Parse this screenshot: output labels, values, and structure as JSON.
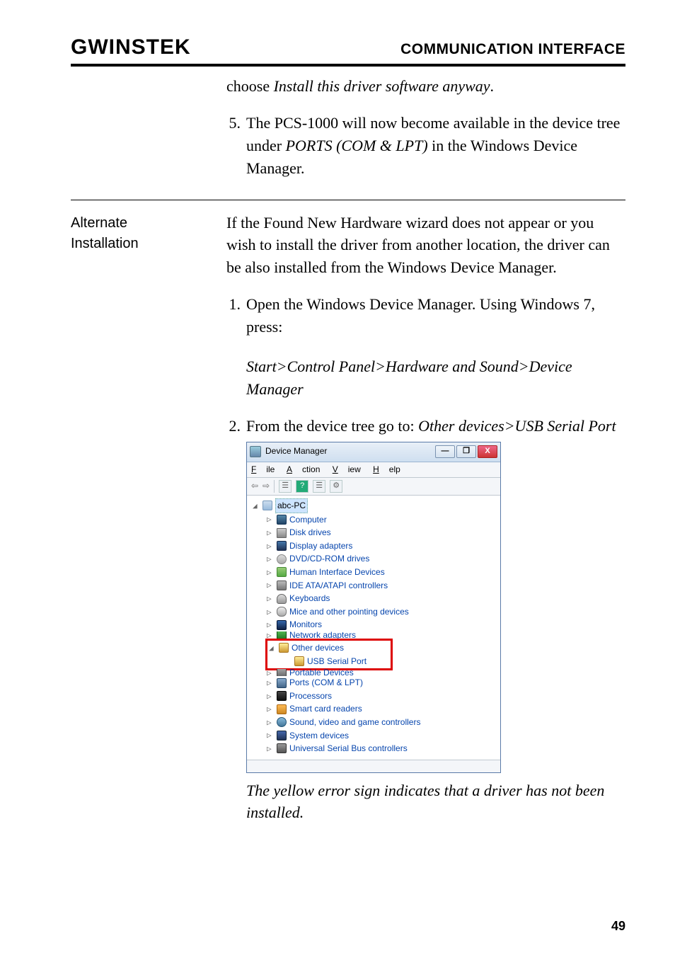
{
  "header": {
    "logo": "GWINSTEK",
    "section": "COMMUNICATION INTERFACE"
  },
  "top_block": {
    "choose_line_prefix": "choose ",
    "choose_line_italic": "Install this driver software anyway",
    "choose_line_suffix": ".",
    "step5_num": "5.",
    "step5_a": "The PCS-1000 will now become available in the device tree under ",
    "step5_i": "PORTS (COM & LPT)",
    "step5_b": " in the Windows Device Manager."
  },
  "alt": {
    "label_a": "Alternate",
    "label_b": "Installation",
    "intro": "If the Found New Hardware wizard does not appear or you wish to install the driver from another location, the driver can be also installed from the Windows Device Manager.",
    "step1_num": "1.",
    "step1_a": "Open the Windows Device Manager. Using Windows 7, press:",
    "step1_path": "Start>Control Panel>Hardware and Sound>Device Manager",
    "step2_num": "2.",
    "step2_a": "From the device tree go to: ",
    "step2_i": "Other devices>USB Serial Port"
  },
  "dm": {
    "title": "Device Manager",
    "min": "—",
    "restore": "❐",
    "close": "X",
    "menu": {
      "file": "File",
      "action": "Action",
      "view": "View",
      "help": "Help"
    },
    "tb_back": "⇦",
    "tb_fwd": "⇨",
    "tb_prop": "☰",
    "tb_help": "?",
    "tb_scan": "☰",
    "tb_upd": "⚙",
    "root": "abc-PC",
    "nodes": {
      "computer": "Computer",
      "disk": "Disk drives",
      "display": "Display adapters",
      "dvd": "DVD/CD-ROM drives",
      "hid": "Human Interface Devices",
      "ide": "IDE ATA/ATAPI controllers",
      "kbd": "Keyboards",
      "mice": "Mice and other pointing devices",
      "mon": "Monitors",
      "net": "Network adapters",
      "other": "Other devices",
      "usbserial": "USB Serial Port",
      "portable": "Portable Devices",
      "ports": "Ports (COM & LPT)",
      "proc": "Processors",
      "smart": "Smart card readers",
      "sound": "Sound, video and game controllers",
      "sys": "System devices",
      "usbctl": "Universal Serial Bus controllers"
    }
  },
  "caption": "The yellow error sign indicates that a driver has not been installed.",
  "page": "49"
}
